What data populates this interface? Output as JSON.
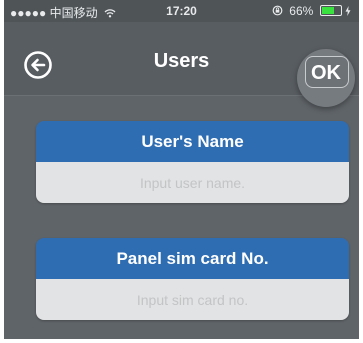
{
  "status_bar": {
    "carrier": "●●●●● 中国移动",
    "time": "17:20",
    "battery_text": "66%",
    "battery_level": 0.66,
    "battery_color": "#39e23f"
  },
  "nav": {
    "title": "Users",
    "back_icon": "back-arrow-circle-icon",
    "ok_label": "OK"
  },
  "form": {
    "name_section": {
      "header": "User's Name",
      "placeholder": "Input user name."
    },
    "sim_section": {
      "header": "Panel sim card No.",
      "placeholder": "Input sim card no."
    }
  },
  "colors": {
    "accent": "#2f6db2",
    "background": "#5f6468"
  }
}
